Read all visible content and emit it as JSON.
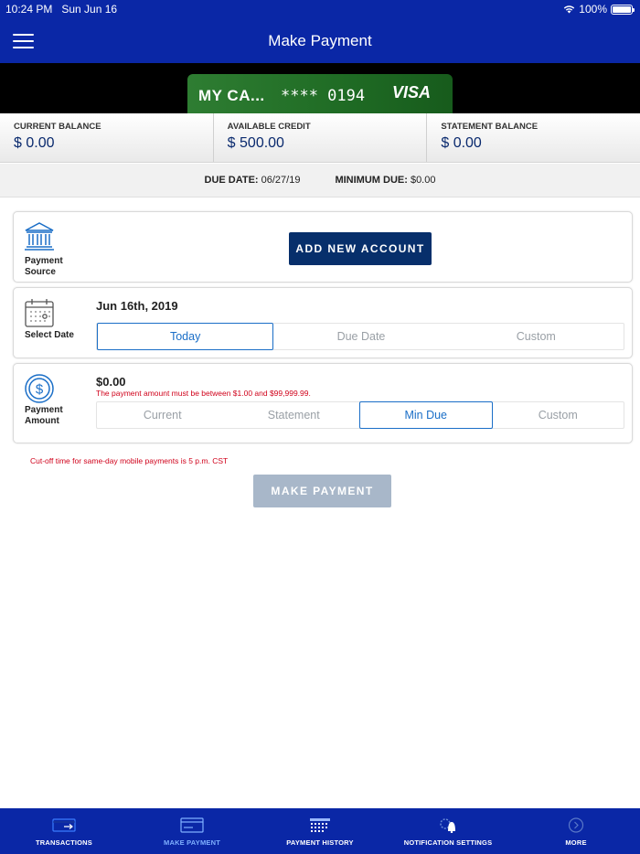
{
  "status_bar": {
    "time_date": "10:24 PM   Sun Jun 16",
    "battery": "100%",
    "battery_level": 1.0
  },
  "header": {
    "title": "Make Payment"
  },
  "card": {
    "name": "MY CA...",
    "number": "**** 0194",
    "brand": "VISA"
  },
  "balances": [
    {
      "label": "CURRENT BALANCE",
      "value": "$ 0.00"
    },
    {
      "label": "AVAILABLE CREDIT",
      "value": "$ 500.00"
    },
    {
      "label": "STATEMENT BALANCE",
      "value": "$ 0.00"
    }
  ],
  "due": {
    "due_date_label": "DUE DATE:",
    "due_date_value": " 06/27/19",
    "min_due_label": "MINIMUM DUE:",
    "min_due_value": " $0.00"
  },
  "payment_source": {
    "label_line1": "Payment",
    "label_line2": "Source",
    "add_button": "ADD NEW ACCOUNT"
  },
  "select_date": {
    "label": "Select Date",
    "date": "Jun 16th, 2019",
    "options": [
      "Today",
      "Due Date",
      "Custom"
    ],
    "selected": "Today"
  },
  "payment_amount": {
    "label_line1": "Payment",
    "label_line2": "Amount",
    "amount": "$0.00",
    "error": "The payment amount must be between $1.00 and $99,999.99.",
    "options": [
      "Current",
      "Statement",
      "Min Due",
      "Custom"
    ],
    "selected": "Min Due"
  },
  "cutoff_note": "Cut-off time for same-day mobile payments is 5 p.m. CST",
  "make_payment_button": "MAKE PAYMENT",
  "tabs": [
    {
      "label": "TRANSACTIONS",
      "icon": "card-arrow-icon"
    },
    {
      "label": "MAKE PAYMENT",
      "icon": "card-icon",
      "active": true
    },
    {
      "label": "PAYMENT HISTORY",
      "icon": "calendar-grid-icon"
    },
    {
      "label": "NOTIFICATION SETTINGS",
      "icon": "bell-gear-icon"
    },
    {
      "label": "MORE",
      "icon": "chevron-circle-icon"
    }
  ],
  "colors": {
    "header_blue": "#0a27a6",
    "button_navy": "#072f6b",
    "active_blue": "#1a6ec7",
    "error_red": "#d0021b",
    "disabled_button": "#a8b7c9"
  }
}
